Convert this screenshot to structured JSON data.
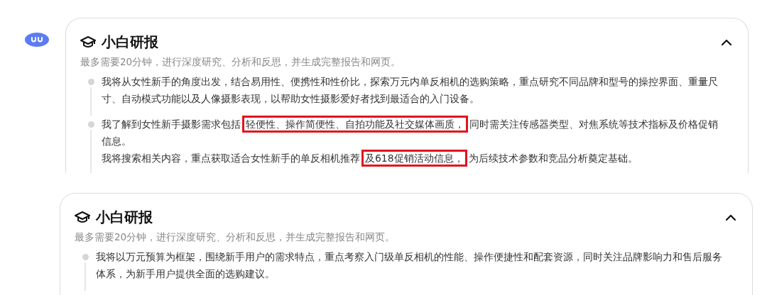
{
  "cards": [
    {
      "title": "小白研报",
      "subtitle": "最多需要20分钟，进行深度研究、分析和反思，并生成完整报告和网页。",
      "expanded": true,
      "steps": [
        {
          "paragraphs": [
            [
              {
                "text": "我将从女性新手的角度出发，结合易用性、便携性和性价比，探索万元内单反相机的选购策略，重点研究不同品牌和型号的操控界面、重量尺寸、自动模式功能以及人像摄影表现，以帮助女性摄影爱好者找到最适合的入门设备。",
                "highlighted": false
              }
            ]
          ]
        },
        {
          "paragraphs": [
            [
              {
                "text": "我了解到女性新手摄影需求包括",
                "highlighted": false
              },
              {
                "text": "轻便性、操作简便性、自拍功能及社交媒体画质，",
                "highlighted": true
              },
              {
                "text": "同时需关注传感器类型、对焦系统等技术指标及价格促销信息。",
                "highlighted": false
              }
            ],
            [
              {
                "text": "我将搜索相关内容，重点获取适合女性新手的单反相机推荐",
                "highlighted": false
              },
              {
                "text": "及618促销活动信息，",
                "highlighted": true
              },
              {
                "text": "为后续技术参数和竞品分析奠定基础。",
                "highlighted": false
              }
            ]
          ]
        }
      ]
    },
    {
      "title": "小白研报",
      "subtitle": "最多需要20分钟，进行深度研究、分析和反思，并生成完整报告和网页。",
      "expanded": true,
      "steps": [
        {
          "paragraphs": [
            [
              {
                "text": "我将以万元预算为框架，围绕新手用户的需求特点，重点考察入门级单反相机的性能、操作便捷性和配套资源，同时关注品牌影响力和售后服务体系，为新手用户提供全面的选购建议。",
                "highlighted": false
              }
            ]
          ]
        }
      ]
    }
  ]
}
